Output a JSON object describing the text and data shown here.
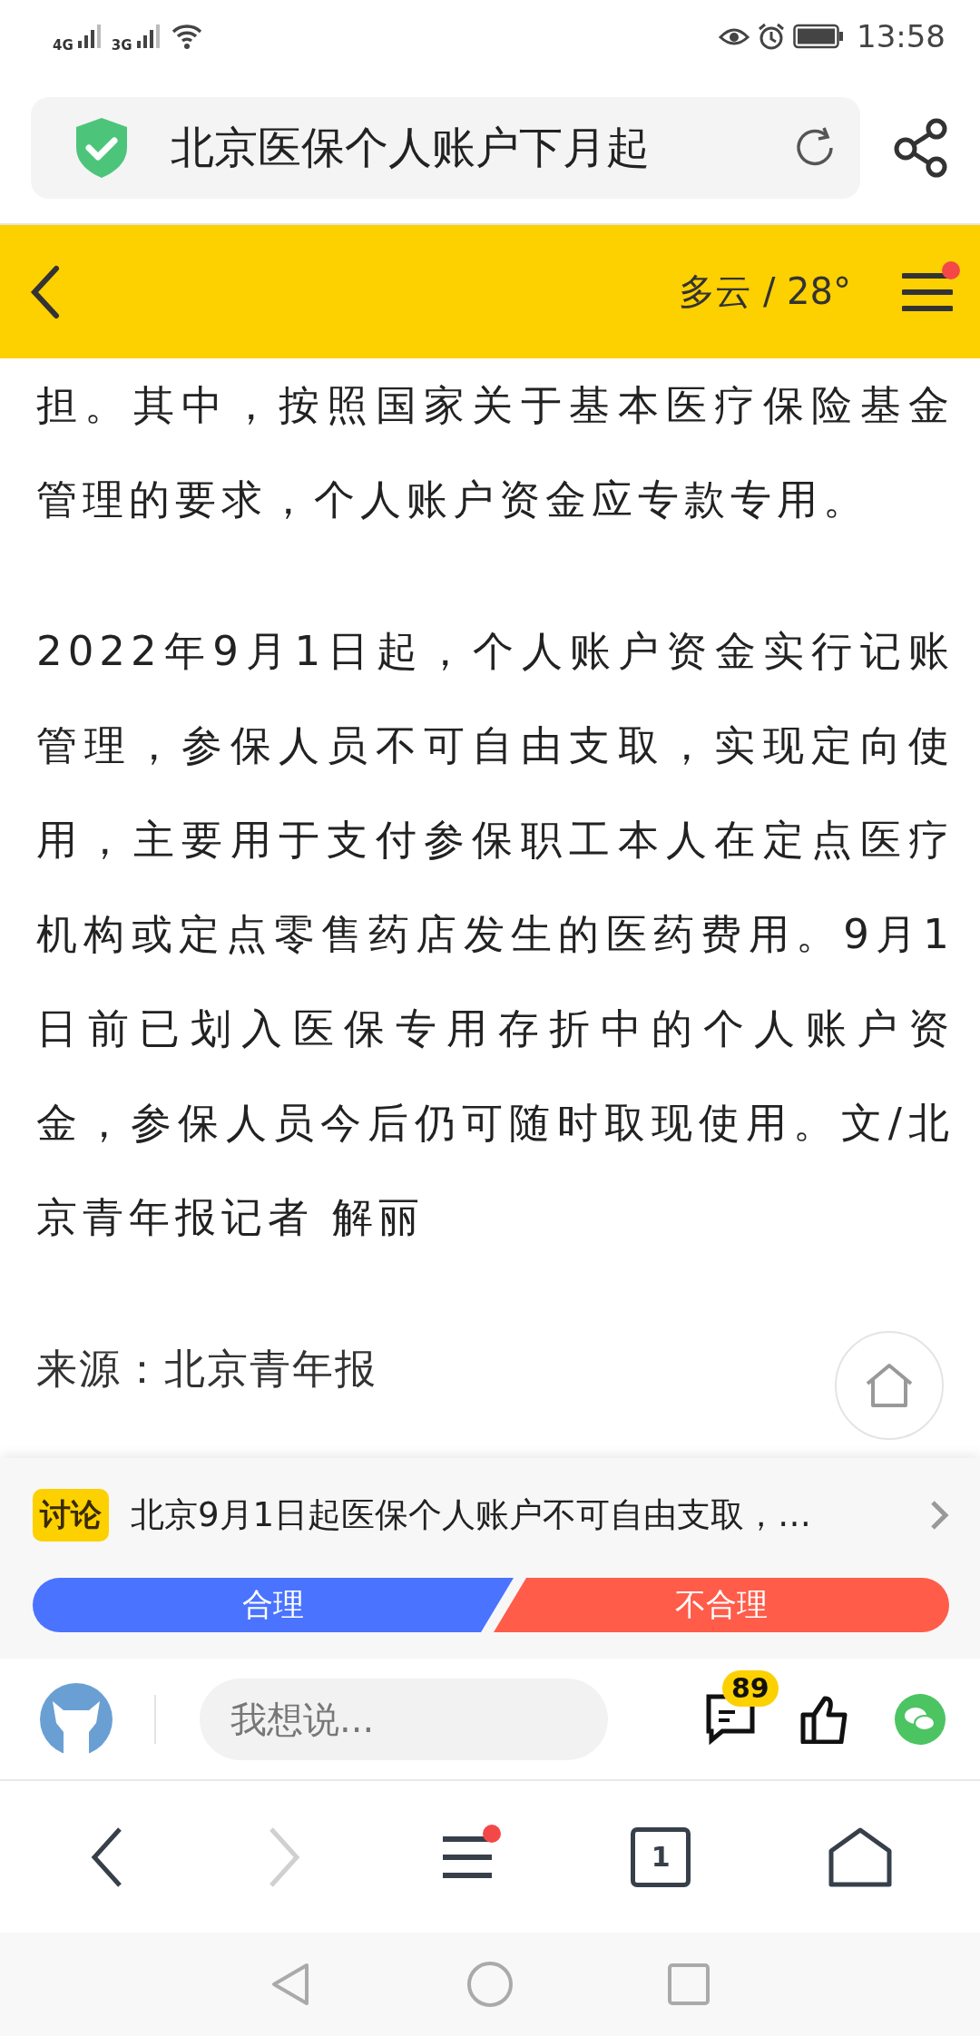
{
  "status_bar": {
    "network_1": "4G",
    "network_2": "3G",
    "time": "13:58"
  },
  "address_bar": {
    "title": "北京医保个人账户下月起"
  },
  "top_bar": {
    "weather": "多云 / 28°",
    "menu_badge": true
  },
  "article": {
    "paragraphs": [
      "担。其中，按照国家关于基本医疗保险基金管理的要求，个人账户资金应专款专用。",
      "2022年9月1日起，个人账户资金实行记账管理，参保人员不可自由支取，实现定向使用，主要用于支付参保职工本人在定点医疗机构或定点零售药店发生的医药费用。9月1日前已划入医保专用存折中的个人账户资金，参保人员今后仍可随时取现使用。文/北京青年报记者 解丽"
    ],
    "source": "来源：北京青年报"
  },
  "discussion": {
    "tag": "讨论",
    "title": "北京9月1日起医保个人账户不可自由支取，…",
    "options": [
      {
        "label": "合理",
        "kind": "agree"
      },
      {
        "label": "不合理",
        "kind": "disagree"
      }
    ]
  },
  "comment_bar": {
    "placeholder": "我想说...",
    "comment_count": "89"
  },
  "nav": {
    "forward_disabled": true,
    "menu_badge": true,
    "tab_count": "1"
  }
}
